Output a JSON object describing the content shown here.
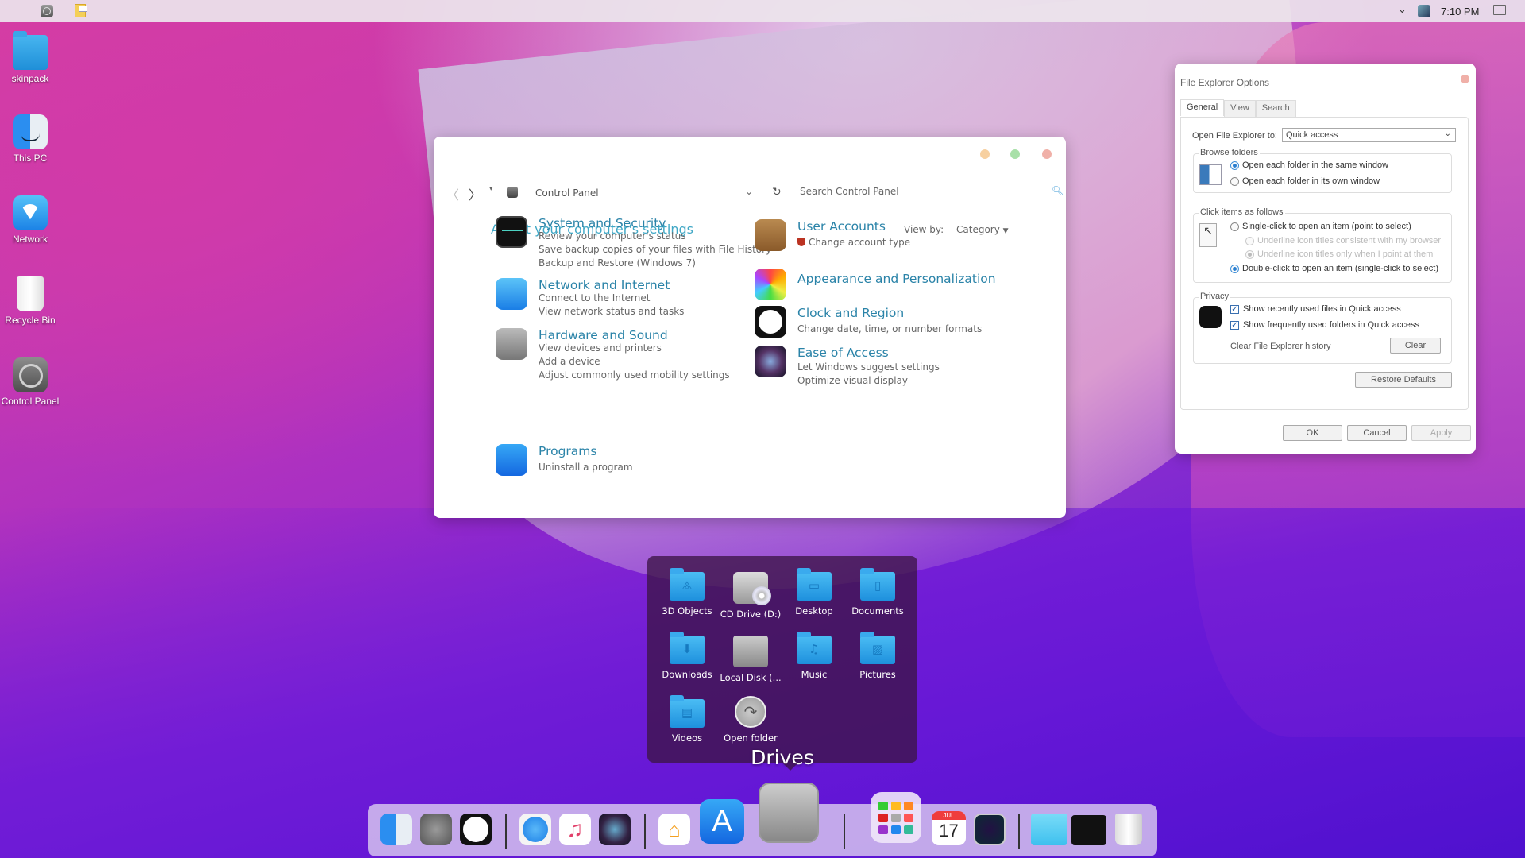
{
  "menubar": {
    "apple_icon": "apple-logo-icon",
    "items": [
      {
        "icon": "system-preferences-icon"
      },
      {
        "icon": "sticky-notes-icon"
      }
    ],
    "tray": {
      "chevron_icon": "chevron-down-icon",
      "app_icon": "virtualbox-icon",
      "clock": "7:10 PM",
      "notification_icon": "action-center-icon"
    }
  },
  "desktop_icons": [
    {
      "label": "skinpack",
      "icon": "user-folder-icon"
    },
    {
      "label": "This PC",
      "icon": "finder-icon"
    },
    {
      "label": "Network",
      "icon": "wifi-icon"
    },
    {
      "label": "Recycle Bin",
      "icon": "trash-icon"
    },
    {
      "label": "Control Panel",
      "icon": "gear-icon"
    }
  ],
  "control_panel": {
    "address": "Control Panel",
    "search_placeholder": "Search Control Panel",
    "heading": "Adjust your computer's settings",
    "view_by_label": "View by:",
    "view_by_value": "Category",
    "categories_left": [
      {
        "title": "System and Security",
        "links": [
          "Review your computer's status",
          "Save backup copies of your files with File History",
          "Backup and Restore (Windows 7)"
        ]
      },
      {
        "title": "Network and Internet",
        "links": [
          "Connect to the Internet",
          "View network status and tasks"
        ]
      },
      {
        "title": "Hardware and Sound",
        "links": [
          "View devices and printers",
          "Add a device",
          "Adjust commonly used mobility settings"
        ]
      },
      {
        "title": "Programs",
        "links": [
          "Uninstall a program"
        ]
      }
    ],
    "categories_right": [
      {
        "title": "User Accounts",
        "links": [
          "Change account type"
        ]
      },
      {
        "title": "Appearance and Personalization",
        "links": []
      },
      {
        "title": "Clock and Region",
        "links": [
          "Change date, time, or number formats"
        ]
      },
      {
        "title": "Ease of Access",
        "links": [
          "Let Windows suggest settings",
          "Optimize visual display"
        ]
      }
    ]
  },
  "file_explorer_options": {
    "title": "File Explorer Options",
    "tabs": [
      "General",
      "View",
      "Search"
    ],
    "active_tab": "General",
    "open_to_label": "Open File Explorer to:",
    "open_to_value": "Quick access",
    "browse_folders": {
      "label": "Browse folders",
      "options": [
        {
          "label": "Open each folder in the same window",
          "selected": true
        },
        {
          "label": "Open each folder in its own window",
          "selected": false
        }
      ]
    },
    "click_items": {
      "label": "Click items as follows",
      "options": [
        {
          "label": "Single-click to open an item (point to select)",
          "selected": false,
          "disabled": false
        },
        {
          "label": "Underline icon titles consistent with my browser",
          "selected": false,
          "disabled": true
        },
        {
          "label": "Underline icon titles only when I point at them",
          "selected": true,
          "disabled": true
        },
        {
          "label": "Double-click to open an item (single-click to select)",
          "selected": true,
          "disabled": false
        }
      ]
    },
    "privacy": {
      "label": "Privacy",
      "checks": [
        {
          "label": "Show recently used files in Quick access",
          "checked": true
        },
        {
          "label": "Show frequently used folders in Quick access",
          "checked": true
        }
      ],
      "clear_history_label": "Clear File Explorer history",
      "clear_button": "Clear"
    },
    "restore_defaults": "Restore Defaults",
    "buttons": {
      "ok": "OK",
      "cancel": "Cancel",
      "apply": "Apply"
    }
  },
  "drives_popup": {
    "title": "Drives",
    "items": [
      {
        "label": "3D Objects",
        "glyph": "⟁"
      },
      {
        "label": "CD Drive (D:)",
        "glyph": ""
      },
      {
        "label": "Desktop",
        "glyph": "▭"
      },
      {
        "label": "Documents",
        "glyph": "▯"
      },
      {
        "label": "Downloads",
        "glyph": "⬇"
      },
      {
        "label": "Local Disk (...",
        "glyph": ""
      },
      {
        "label": "Music",
        "glyph": "♫"
      },
      {
        "label": "Pictures",
        "glyph": "▨"
      },
      {
        "label": "Videos",
        "glyph": "▤"
      },
      {
        "label": "Open folder",
        "glyph": "↷"
      }
    ]
  },
  "dock": {
    "apps": [
      "Finder",
      "System Preferences",
      "Clock",
      "Safari",
      "Music",
      "Siri",
      "Home",
      "App Store",
      "Drives",
      "Launchpad",
      "Calendar",
      "Time Machine",
      "Folder",
      "Multitasking",
      "Trash"
    ],
    "calendar": {
      "month": "JUL",
      "day": "17"
    },
    "music_glyph": "♫",
    "home_glyph": "⌂",
    "store_glyph": "A"
  }
}
